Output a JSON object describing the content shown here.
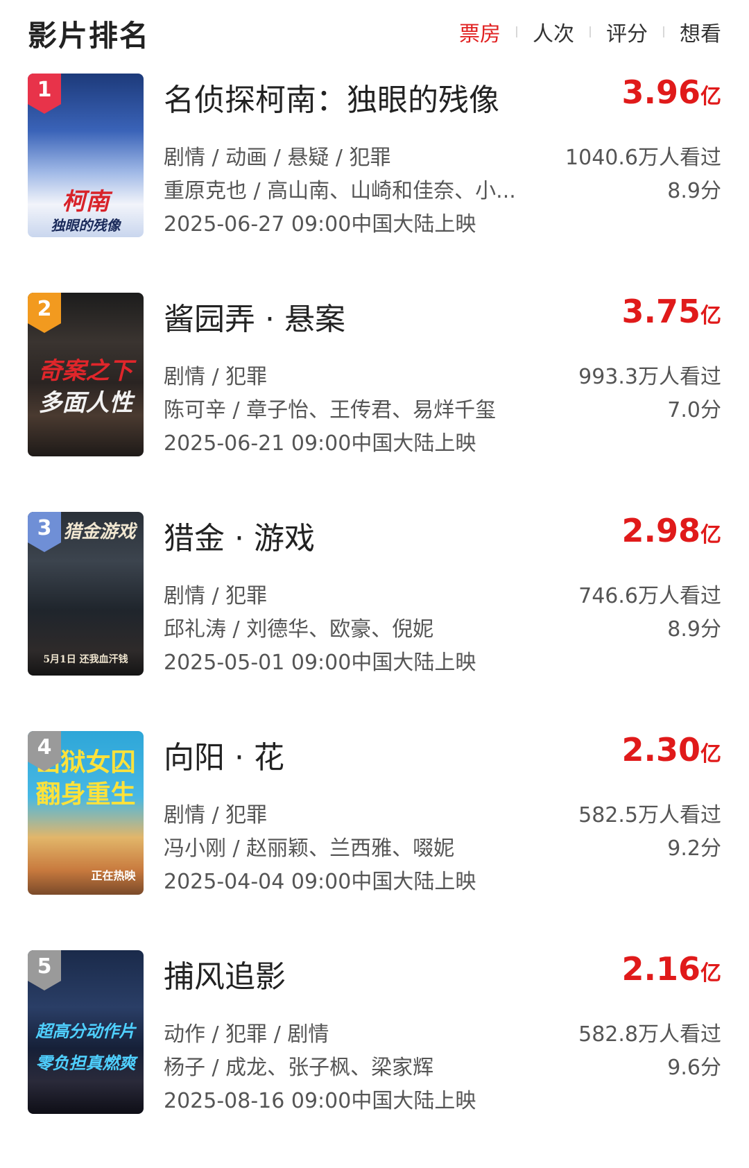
{
  "header": {
    "title": "影片排名",
    "tabs": [
      {
        "label": "票房",
        "active": true
      },
      {
        "label": "人次",
        "active": false
      },
      {
        "label": "评分",
        "active": false
      },
      {
        "label": "想看",
        "active": false
      }
    ]
  },
  "colors": {
    "accent": "#e01a1a",
    "rank1": "#e8334a",
    "rank2": "#f29a1f",
    "rank3": "#6f8fd6",
    "rank_other": "#9a9a9a"
  },
  "movies": [
    {
      "rank": "1",
      "title": "名侦探柯南：独眼的残像",
      "box_office": "3.96",
      "unit": "亿",
      "genres": "剧情 / 动画 / 悬疑 / 犯罪",
      "cast": "重原克也 / 高山南、山崎和佳奈、小...",
      "release": "2025-06-27 09:00中国大陆上映",
      "viewers": "1040.6万人看过",
      "score": "8.9分",
      "poster_text": [
        "柯南",
        "独眼的残像"
      ]
    },
    {
      "rank": "2",
      "title": "酱园弄 · 悬案",
      "box_office": "3.75",
      "unit": "亿",
      "genres": "剧情 / 犯罪",
      "cast": "陈可辛 / 章子怡、王传君、易烊千玺",
      "release": "2025-06-21 09:00中国大陆上映",
      "viewers": "993.3万人看过",
      "score": "7.0分",
      "poster_text": [
        "奇案之下",
        "多面人性"
      ]
    },
    {
      "rank": "3",
      "title": "猎金 · 游戏",
      "box_office": "2.98",
      "unit": "亿",
      "genres": "剧情 / 犯罪",
      "cast": "邱礼涛 / 刘德华、欧豪、倪妮",
      "release": "2025-05-01 09:00中国大陆上映",
      "viewers": "746.6万人看过",
      "score": "8.9分",
      "poster_text": [
        "猎金游戏",
        "5月1日 还我血汗钱"
      ]
    },
    {
      "rank": "4",
      "title": "向阳 · 花",
      "box_office": "2.30",
      "unit": "亿",
      "genres": "剧情 / 犯罪",
      "cast": "冯小刚 / 赵丽颖、兰西雅、啜妮",
      "release": "2025-04-04 09:00中国大陆上映",
      "viewers": "582.5万人看过",
      "score": "9.2分",
      "poster_text": [
        "出狱女囚",
        "翻身重生",
        "正在热映"
      ]
    },
    {
      "rank": "5",
      "title": "捕风追影",
      "box_office": "2.16",
      "unit": "亿",
      "genres": "动作 / 犯罪 / 剧情",
      "cast": "杨子 / 成龙、张子枫、梁家辉",
      "release": "2025-08-16 09:00中国大陆上映",
      "viewers": "582.8万人看过",
      "score": "9.6分",
      "poster_text": [
        "超高分动作片",
        "零负担真燃爽"
      ]
    }
  ]
}
